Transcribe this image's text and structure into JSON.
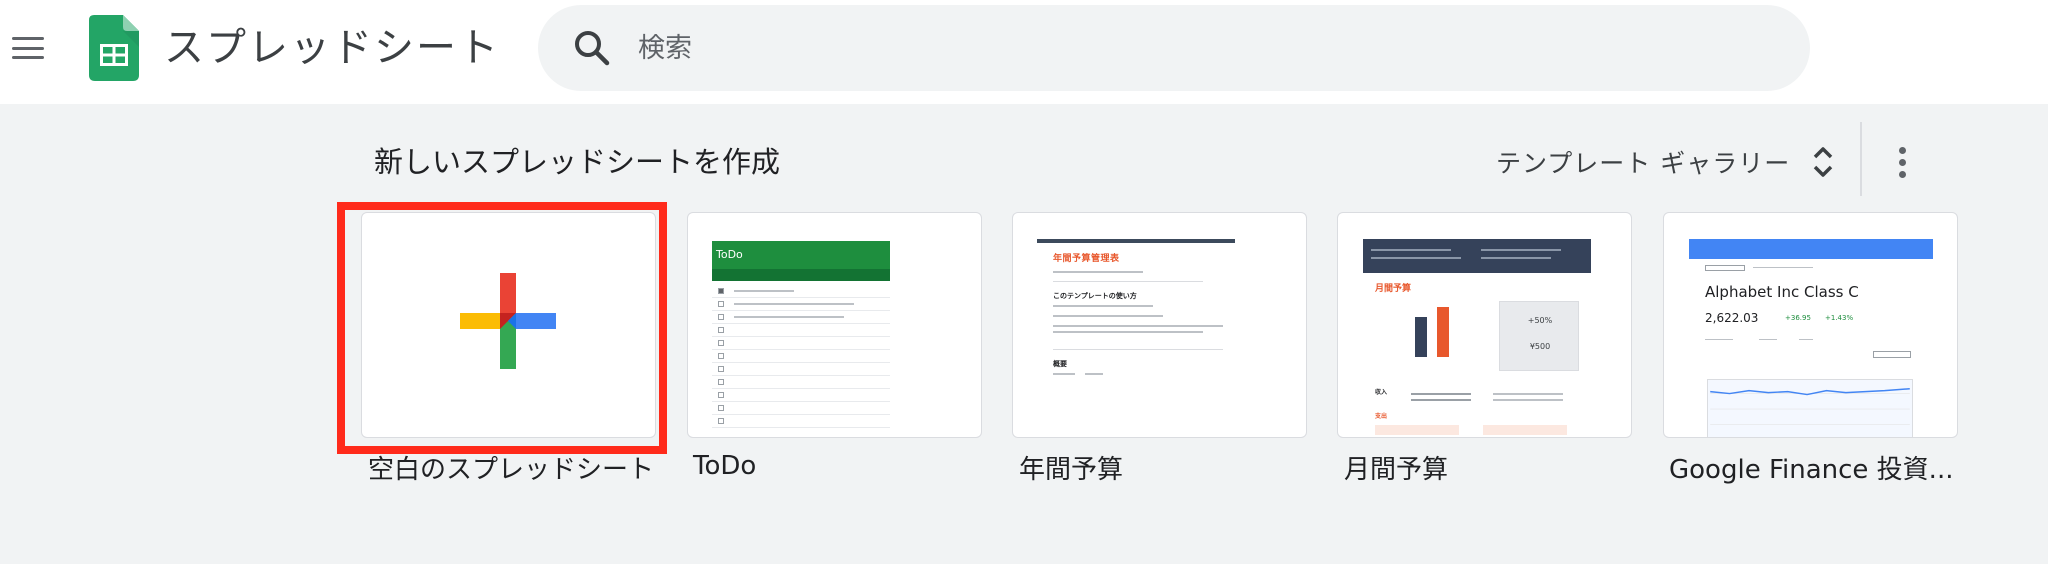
{
  "header": {
    "menu_icon": "hamburger-menu-icon",
    "logo_icon": "google-sheets-logo-icon",
    "app_title": "スプレッドシート",
    "search": {
      "placeholder": "検索",
      "value": "",
      "icon": "search-icon"
    }
  },
  "templates": {
    "section_title": "新しいスプレッドシートを作成",
    "gallery_label": "テンプレート ギャラリー",
    "gallery_icon": "unfold-more-icon",
    "more_icon": "more-vert-icon",
    "highlight_color": "#ff2a1b",
    "items": [
      {
        "label": "空白のスプレッドシート",
        "thumb": {
          "icon": "plus-icon",
          "colors": [
            "#ea4335",
            "#fbbc04",
            "#4285f4",
            "#34a853"
          ]
        }
      },
      {
        "label": "ToDo",
        "thumb": {
          "title": "ToDo",
          "accent": "#1e8e3e"
        }
      },
      {
        "label": "年間予算",
        "thumb": {
          "title": "年間予算管理表",
          "subtitle": "このテンプレートの使い方",
          "section": "概要"
        }
      },
      {
        "label": "月間予算",
        "thumb": {
          "title": "月間予算",
          "big_value": "+50%",
          "value2": "¥500",
          "sec_income": "収入",
          "sec_expense": "支出"
        }
      },
      {
        "label": "Google Finance 投資...",
        "thumb": {
          "name": "Alphabet Inc Class C",
          "price": "2,622.03",
          "change": "+36.95",
          "change_pct": "+1.43%"
        }
      }
    ]
  }
}
